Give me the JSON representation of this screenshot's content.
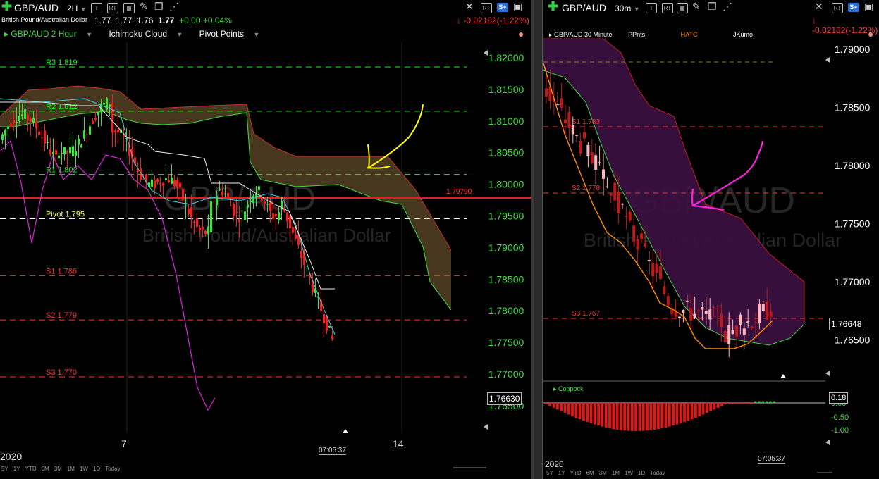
{
  "left": {
    "symbol": "GBP/AUD",
    "timeframe": "2H",
    "description": "British Pound/Australian Dollar",
    "ohlc": [
      "1.77",
      "1.77",
      "1.76",
      "1.77"
    ],
    "change_abs": "+0.00",
    "change_pct": "+0.04%",
    "daily_change": "-0.02182(-1.22%)",
    "legend": {
      "series": "GBP/AUD 2 Hour",
      "study1": "Ichimoku Cloud",
      "study2": "Pivot Points"
    },
    "watermark_1": "GBP/AUD",
    "watermark_2": "British Pound/Australian Dollar",
    "axis_ticks": [
      "1.82000",
      "1.81500",
      "1.81000",
      "1.80500",
      "1.80000",
      "1.79500",
      "1.79000",
      "1.78500",
      "1.78000",
      "1.77500",
      "1.77000",
      "1.76500"
    ],
    "last_price": "1.76630",
    "red_level": "1.79790",
    "pivot_labels": {
      "r3": "R3 1.819",
      "r2": "R2 1.812",
      "r1": "R1 1.802",
      "pivot": "Pivot 1.795",
      "s1": "S1 1.786",
      "s2": "S2 1.779",
      "s3": "S3 1.770"
    },
    "dates": {
      "year": "2020",
      "d1": "7",
      "d2": "14"
    },
    "time": "07:05:37",
    "ranges": [
      "5Y",
      "1Y",
      "YTD",
      "6M",
      "3M",
      "1M",
      "1W",
      "1D",
      "Today"
    ],
    "colors": {
      "bull": "#39e639",
      "bear": "#ff1a1a",
      "pivot": "#00ff00",
      "support": "#ff3030",
      "cloud": "#4a3a20",
      "annotation": "#ffff00"
    }
  },
  "right": {
    "symbol": "GBP/AUD",
    "timeframe": "30m",
    "daily_change": "-0.02182(-1.22%)",
    "legend": {
      "series": "GBP/AUD 30 Minute",
      "study1": "PPnts",
      "study2": "HATC",
      "study3": "JKumo"
    },
    "watermark_1": "GBP/AUD",
    "watermark_2": "British Pound/Australian Dollar",
    "axis_ticks": [
      "1.79000",
      "1.78500",
      "1.78000",
      "1.77500",
      "1.77000",
      "1.76500"
    ],
    "last_price": "1.76648",
    "pivot_labels": {
      "s1": "S1 1.783",
      "s2": "S2 1.778",
      "s3": "S3 1.767"
    },
    "indicator": {
      "name": "Coppock",
      "value": "0.18",
      "ticks": [
        "0.00",
        "-0.50",
        "-1.00"
      ]
    },
    "dates": {
      "year": "2020"
    },
    "time": "07:05:37",
    "ranges": [
      "5Y",
      "1Y",
      "YTD",
      "6M",
      "3M",
      "1M",
      "1W",
      "1D",
      "Today"
    ],
    "colors": {
      "bull": "#ffb6c1",
      "bear": "#c01818",
      "cloud": "#3a1040",
      "annotation": "#ff22dd"
    }
  }
}
